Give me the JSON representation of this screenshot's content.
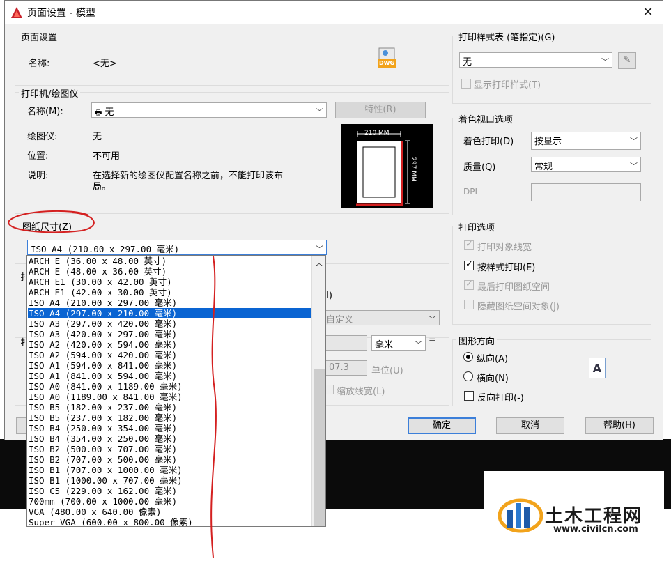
{
  "window": {
    "title": "页面设置 - 模型",
    "close": "✕"
  },
  "page_setup": {
    "group_label": "页面设置",
    "name_label": "名称:",
    "name_value": "<无>",
    "dwg_badge": "DWG"
  },
  "printer": {
    "group_label": "打印机/绘图仪",
    "name_label": "名称(M):",
    "name_value": "无",
    "properties_button": "特性(R)",
    "plotter_label": "绘图仪:",
    "plotter_value": "无",
    "location_label": "位置:",
    "location_value": "不可用",
    "description_label": "说明:",
    "description_line1": "在选择新的绘图仪配置名称之前，不能打印该布",
    "description_line2": "局。",
    "preview_width": "210 MM",
    "preview_height": "297 MM"
  },
  "paper_size": {
    "group_label": "图纸尺寸(Z)",
    "selected": "ISO A4 (210.00 x 297.00 毫米)",
    "options": [
      "ARCH E (36.00 x 48.00 英寸)",
      "ARCH E (48.00 x 36.00 英寸)",
      "ARCH E1 (30.00 x 42.00 英寸)",
      "ARCH E1 (42.00 x 30.00 英寸)",
      "ISO A4 (210.00 x 297.00 毫米)",
      "ISO A4 (297.00 x 210.00 毫米)",
      "ISO A3 (297.00 x 420.00 毫米)",
      "ISO A3 (420.00 x 297.00 毫米)",
      "ISO A2 (420.00 x 594.00 毫米)",
      "ISO A2 (594.00 x 420.00 毫米)",
      "ISO A1 (594.00 x 841.00 毫米)",
      "ISO A1 (841.00 x 594.00 毫米)",
      "ISO A0 (841.00 x 1189.00 毫米)",
      "ISO A0 (1189.00 x 841.00 毫米)",
      "ISO B5 (182.00 x 237.00 毫米)",
      "ISO B5 (237.00 x 182.00 毫米)",
      "ISO B4 (250.00 x 354.00 毫米)",
      "ISO B4 (354.00 x 250.00 毫米)",
      "ISO B2 (500.00 x 707.00 毫米)",
      "ISO B2 (707.00 x 500.00 毫米)",
      "ISO B1 (707.00 x 1000.00 毫米)",
      "ISO B1 (1000.00 x 707.00 毫米)",
      "ISO C5 (229.00 x 162.00 毫米)",
      "700mm (700.00 x 1000.00 毫米)",
      "VGA (480.00 x 640.00 像素)",
      "Super VGA (600.00 x 800.00 像素)"
    ],
    "highlighted_index": 5
  },
  "hidden_fragments": {
    "left_a": "扌",
    "left_b": "扌",
    "scale_i": "(I)",
    "custom": "自定义",
    "unit_mm": "毫米",
    "equals": "=",
    "value": "07.3",
    "unit_u": "单位(U)",
    "scale_lineweights": "缩放线宽(L)"
  },
  "plot_style_table": {
    "group_label": "打印样式表 (笔指定)(G)",
    "value": "无",
    "display_styles": "显示打印样式(T)"
  },
  "shaded_viewport": {
    "group_label": "着色视口选项",
    "shade_plot_label": "着色打印(D)",
    "shade_plot_value": "按显示",
    "quality_label": "质量(Q)",
    "quality_value": "常规",
    "dpi_label": "DPI"
  },
  "plot_options": {
    "group_label": "打印选项",
    "items": [
      {
        "label": "打印对象线宽",
        "checked": true,
        "enabled": false
      },
      {
        "label": "按样式打印(E)",
        "checked": true,
        "enabled": true
      },
      {
        "label": "最后打印图纸空间",
        "checked": true,
        "enabled": false
      },
      {
        "label": "隐藏图纸空间对象(J)",
        "checked": false,
        "enabled": false
      }
    ]
  },
  "orientation": {
    "group_label": "图形方向",
    "portrait": "纵向(A)",
    "landscape": "横向(N)",
    "upside_down": "反向打印(-)",
    "selected": "portrait",
    "icon_letter": "A"
  },
  "buttons": {
    "ok": "确定",
    "cancel": "取消",
    "help": "帮助(H)"
  },
  "watermark": {
    "name": "土木工程网",
    "url": "www.civilcn.com"
  },
  "colors": {
    "accent": "#0a64d2",
    "annotation_red": "#d42020",
    "ok_border": "#3c7fd9"
  }
}
